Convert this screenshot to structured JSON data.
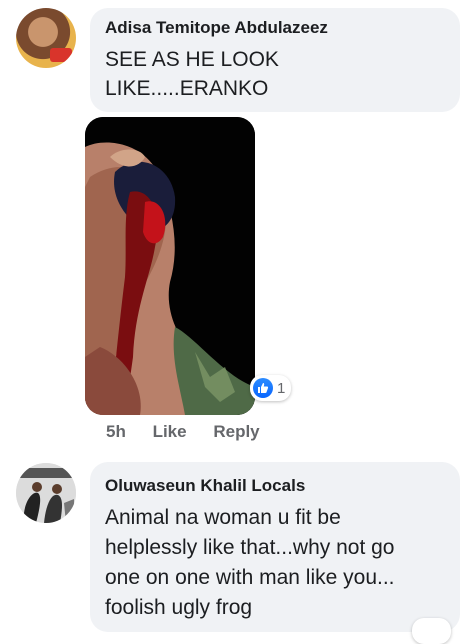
{
  "comments": [
    {
      "author": "Adisa Temitope Abdulazeez",
      "lines": [
        "SEE AS HE LOOK",
        "LIKE.....ERANKO"
      ],
      "reaction_count": "1",
      "time": "5h",
      "like_label": "Like",
      "reply_label": "Reply"
    },
    {
      "author": "Oluwaseun Khalil Locals",
      "lines": [
        "Animal na woman u fit be",
        "helplessly like that...why not go",
        "one on one with man like you...",
        "foolish ugly frog"
      ]
    }
  ],
  "colors": {
    "bubble": "#f0f2f5",
    "like_blue": "#0866ff",
    "meta_gray": "#65676b"
  }
}
